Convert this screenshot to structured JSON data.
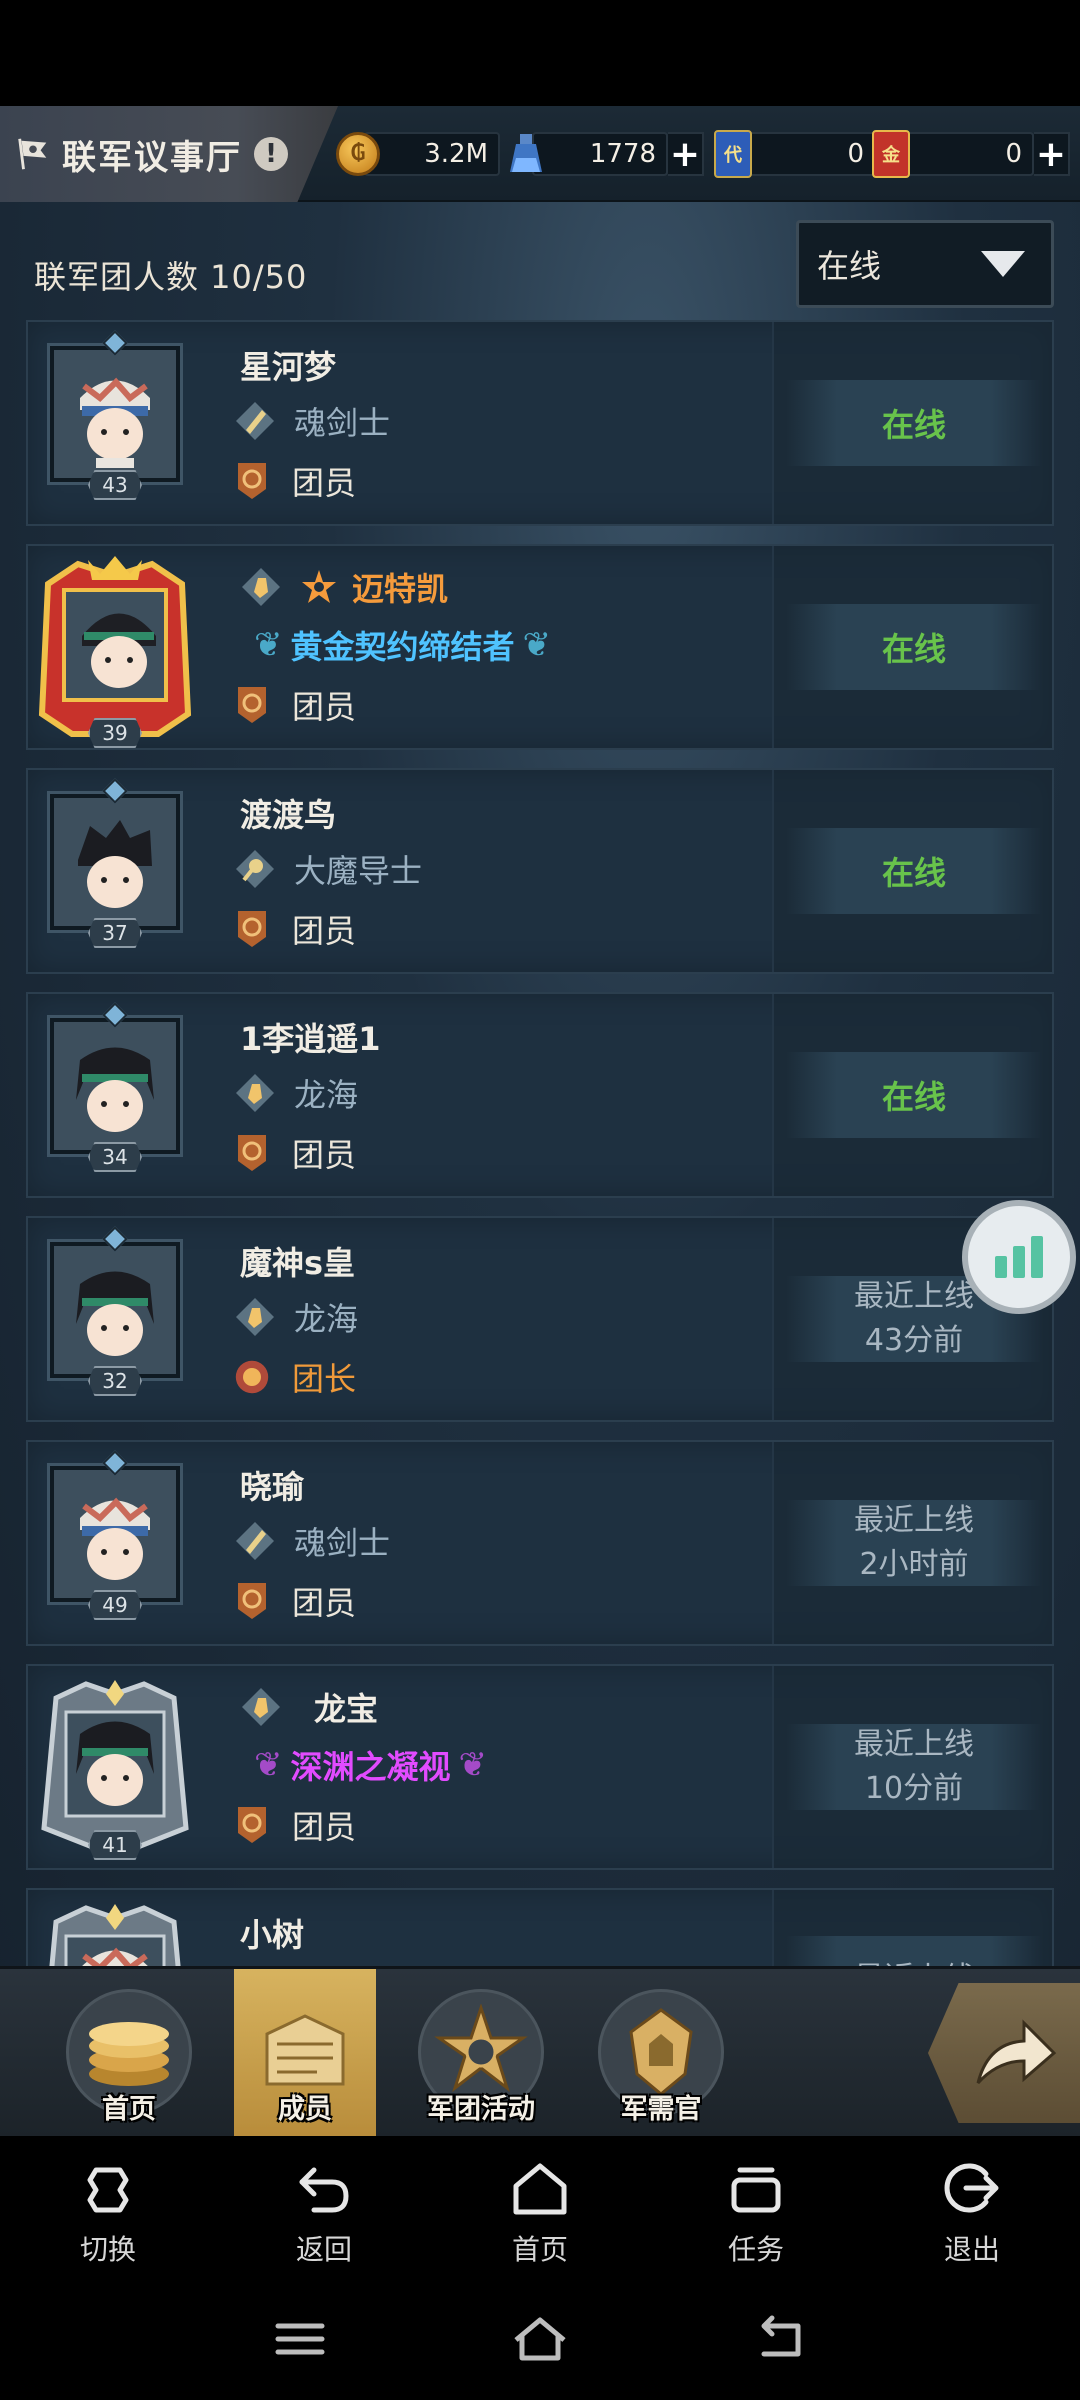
{
  "header": {
    "title": "联军议事厅",
    "alert": "!",
    "resources": [
      {
        "icon": "gold-coin-icon",
        "value": "3.2M"
      },
      {
        "icon": "potion-icon",
        "value": "1778",
        "plus": "+"
      },
      {
        "icon": "blue-card-icon",
        "value": "0"
      },
      {
        "icon": "red-card-icon",
        "value": "0",
        "plus": "+"
      }
    ]
  },
  "members_header": {
    "count_text": "联军团人数 10/50",
    "filter_value": "在线"
  },
  "members": [
    {
      "name": "星河梦",
      "class": "魂剑士",
      "rank": "团员",
      "level": "43",
      "status_line1": "在线",
      "status_line2": "",
      "online": true
    },
    {
      "name": "迈特凯",
      "title": "黄金契约缔结者",
      "rank": "团员",
      "level": "39",
      "status_line1": "在线",
      "status_line2": "",
      "online": true
    },
    {
      "name": "渡渡鸟",
      "class": "大魔导士",
      "rank": "团员",
      "level": "37",
      "status_line1": "在线",
      "status_line2": "",
      "online": true
    },
    {
      "name": "1李逍遥1",
      "class": "龙海",
      "rank": "团员",
      "level": "34",
      "status_line1": "在线",
      "status_line2": "",
      "online": true
    },
    {
      "name": "魔神s皇",
      "class": "龙海",
      "rank": "团长",
      "level": "32",
      "status_line1": "最近上线",
      "status_line2": "43分前",
      "online": false
    },
    {
      "name": "晓瑜",
      "class": "魂剑士",
      "rank": "团员",
      "level": "49",
      "status_line1": "最近上线",
      "status_line2": "2小时前",
      "online": false
    },
    {
      "name": "龙宝",
      "title": "深渊之凝视",
      "rank": "团员",
      "level": "41",
      "status_line1": "最近上线",
      "status_line2": "10分前",
      "online": false
    },
    {
      "name": "小树",
      "status_line1": "最近上线",
      "status_line2": "",
      "online": false
    }
  ],
  "game_nav": {
    "items": [
      {
        "label": "首页",
        "icon": "coins-icon"
      },
      {
        "label": "成员",
        "icon": "members-icon",
        "active": true
      },
      {
        "label": "军团活动",
        "icon": "star-emblem-icon"
      },
      {
        "label": "军需官",
        "icon": "quartermaster-icon"
      }
    ]
  },
  "system_nav": {
    "items": [
      {
        "label": "切换",
        "icon": "switch-icon"
      },
      {
        "label": "返回",
        "icon": "back-icon"
      },
      {
        "label": "首页",
        "icon": "home-icon"
      },
      {
        "label": "任务",
        "icon": "task-icon"
      },
      {
        "label": "退出",
        "icon": "exit-icon"
      }
    ]
  },
  "colors": {
    "online": "#68c34b",
    "leader": "#f09a3a",
    "title_gold": "#4fc3ff",
    "title_purple": "#e24bff",
    "special_name": "#f59b3c"
  }
}
